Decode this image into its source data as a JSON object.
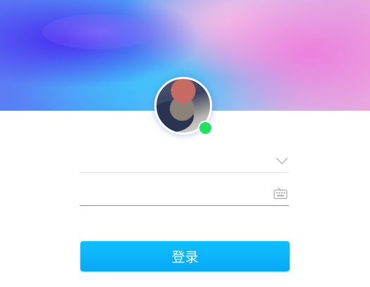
{
  "account": {
    "value": "",
    "placeholder": ""
  },
  "password": {
    "value": "",
    "placeholder": ""
  },
  "login_button": {
    "label": "登录"
  },
  "status": {
    "online": true,
    "color": "#1ee35f"
  },
  "icons": {
    "dropdown": "chevron-down-icon",
    "keyboard": "keyboard-icon"
  },
  "colors": {
    "accent": "#12b7f5",
    "button": "#09a8f5"
  }
}
